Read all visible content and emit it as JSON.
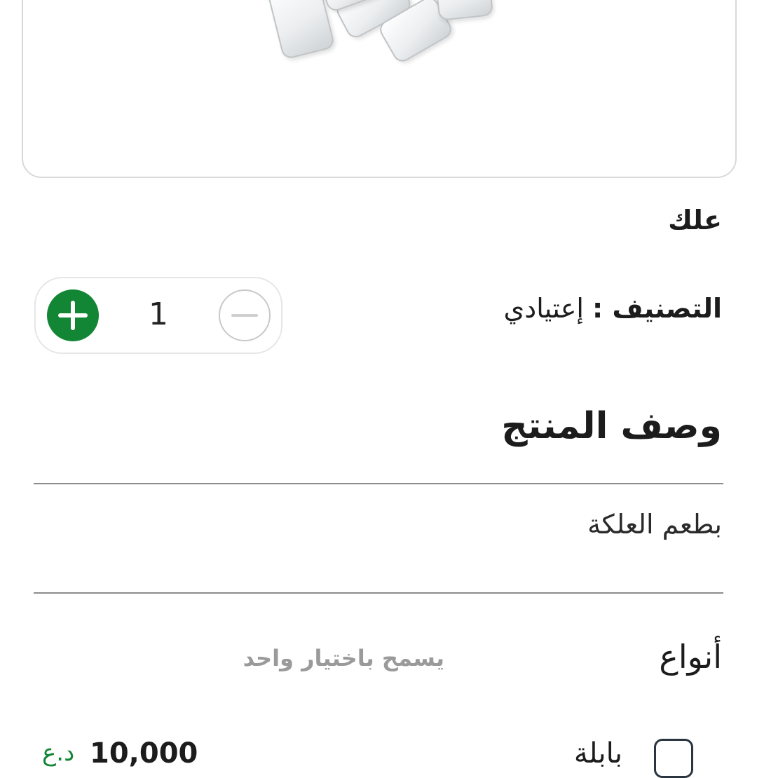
{
  "product": {
    "name": "علك",
    "category_label": "التصنيف :",
    "category_value": "إعتيادي"
  },
  "stepper": {
    "quantity": "1",
    "plus_icon": "plus-icon",
    "minus_icon": "minus-icon",
    "accent_color": "#138636"
  },
  "description": {
    "title": "وصف المنتج",
    "text": "بطعم العلكة"
  },
  "options": {
    "title": "أنواع",
    "hint": "يسمح باختيار واحد",
    "items": [
      {
        "name": "بابلة",
        "price": "10,000",
        "currency": "د.ع",
        "checked": false
      }
    ]
  }
}
